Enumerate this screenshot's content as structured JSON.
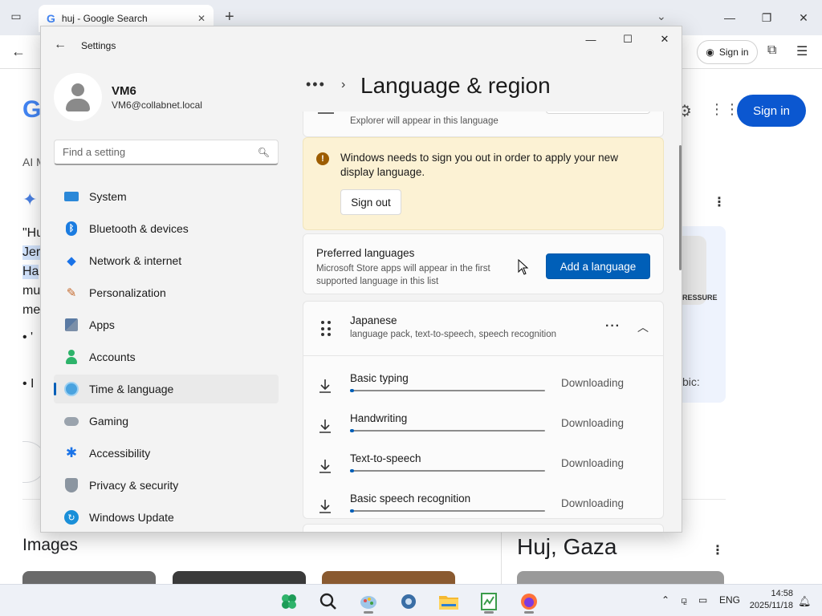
{
  "browser": {
    "tab_title": "huj - Google Search",
    "signin_label": "Sign in",
    "google_signin_label": "Sign in",
    "left_fragments": {
      "logo": "G",
      "ai": "AI M",
      "line1": "\"Hu",
      "line2": "Jer",
      "line3": "Ha",
      "line4": "mu",
      "line5": "me",
      "bullet1": "•  '",
      "bullet2": "•  I"
    },
    "right_fragments": {
      "pill_text": "RESSURE",
      "bic_text": "bic:"
    },
    "images_heading": "Images",
    "knowledge_title": "Huj, Gaza"
  },
  "settings": {
    "window_title": "Settings",
    "user": {
      "name": "VM6",
      "email": "VM6@collabnet.local"
    },
    "search_placeholder": "Find a setting",
    "nav": [
      {
        "label": "System",
        "icon": "system-icon"
      },
      {
        "label": "Bluetooth & devices",
        "icon": "bluetooth-icon"
      },
      {
        "label": "Network & internet",
        "icon": "wifi-icon"
      },
      {
        "label": "Personalization",
        "icon": "brush-icon"
      },
      {
        "label": "Apps",
        "icon": "apps-icon"
      },
      {
        "label": "Accounts",
        "icon": "person-icon"
      },
      {
        "label": "Time & language",
        "icon": "globe-clock-icon",
        "active": true
      },
      {
        "label": "Gaming",
        "icon": "controller-icon"
      },
      {
        "label": "Accessibility",
        "icon": "accessibility-icon"
      },
      {
        "label": "Privacy & security",
        "icon": "shield-icon"
      },
      {
        "label": "Windows Update",
        "icon": "update-icon"
      }
    ],
    "page_title": "Language & region",
    "top_card_text": "Explorer will appear in this language",
    "banner": {
      "message": "Windows needs to sign you out in order to apply your new display language.",
      "button": "Sign out"
    },
    "preferred": {
      "title": "Preferred languages",
      "description": "Microsoft Store apps will appear in the first supported language in this list",
      "button": "Add a language"
    },
    "language": {
      "name": "Japanese",
      "features": "language pack, text-to-speech, speech recognition"
    },
    "downloads": [
      {
        "name": "Basic typing",
        "status": "Downloading",
        "progress": 0.02
      },
      {
        "name": "Handwriting",
        "status": "Downloading",
        "progress": 0.02
      },
      {
        "name": "Text-to-speech",
        "status": "Downloading",
        "progress": 0.02
      },
      {
        "name": "Basic speech recognition",
        "status": "Downloading",
        "progress": 0.02
      }
    ]
  },
  "taskbar": {
    "lang": "ENG",
    "time": "14:58",
    "date": "2025/11/18"
  }
}
